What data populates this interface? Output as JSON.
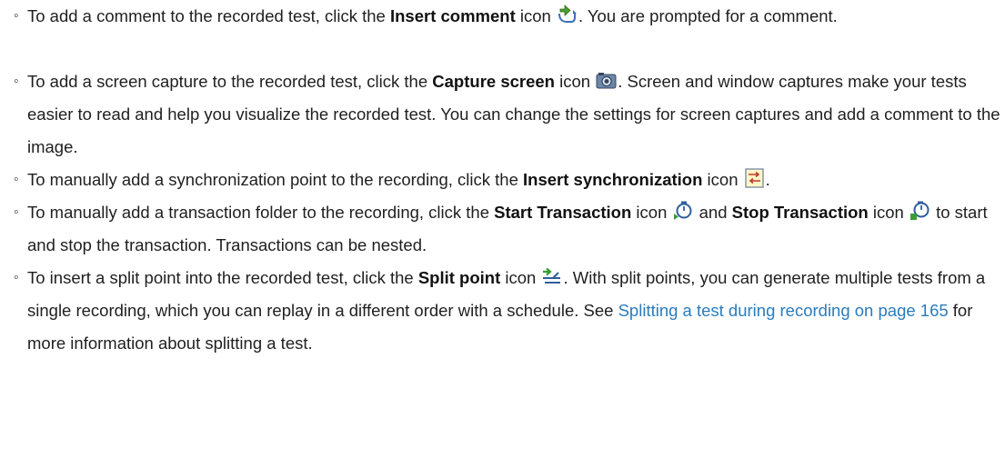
{
  "bullets": [
    {
      "before": "To add a comment to the recorded test, click the ",
      "bold": "Insert comment",
      "mid": " icon ",
      "icon": "insert-comment-icon",
      "after": ". You are prompted for a comment."
    },
    {
      "before": "To add a screen capture to the recorded test, click the ",
      "bold": "Capture screen",
      "mid": " icon ",
      "icon": "camera-icon",
      "after": ". Screen and window captures make your tests easier to read and help you visualize the recorded test. You can change the settings for screen captures and add a comment to the image."
    },
    {
      "before": "To manually add a synchronization point to the recording, click the ",
      "bold": "Insert synchronization",
      "mid": " icon ",
      "icon": "synchronization-icon",
      "after": "."
    },
    {
      "before": "To manually add a transaction folder to the recording, click the ",
      "bold": "Start Transaction",
      "mid": " icon ",
      "icon": "start-transaction-icon",
      "and": " and ",
      "bold2": "Stop Transaction",
      "mid2": " icon ",
      "icon2": "stop-transaction-icon",
      "after": " to start and stop the transaction. Transactions can be nested."
    },
    {
      "before": "To insert a split point into the recorded test, click the ",
      "bold": "Split point",
      "mid": " icon ",
      "icon": "split-point-icon",
      "after": ". With split points, you can generate multiple tests from a single recording, which you can replay in a different order with a schedule. See ",
      "link": "Splitting a test during recording on page 165",
      "after2": " for more information about splitting a test."
    }
  ],
  "colors": {
    "link": "#2a7cbd",
    "text": "#1f1f1f"
  }
}
